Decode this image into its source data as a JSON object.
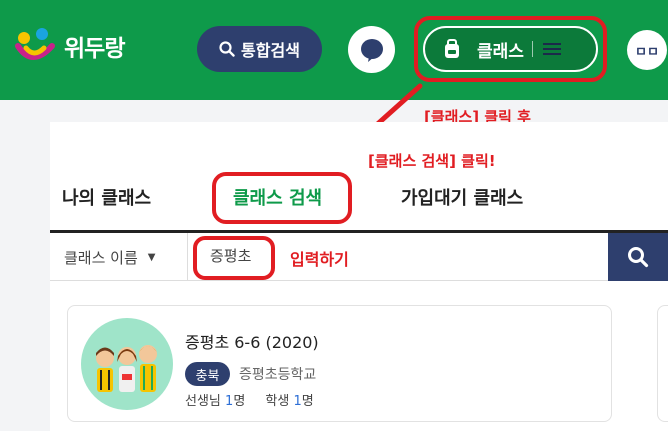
{
  "header": {
    "logo_text": "위두랑",
    "search_label": "통합검색",
    "class_label": "클래스",
    "avatar_label": "ㅁㅁ"
  },
  "annotations": {
    "after_click": "[클래스] 클릭 후",
    "click_search": "[클래스 검색] 클릭!",
    "type_input": "입력하기"
  },
  "tabs": [
    {
      "label": "나의 클래스",
      "active": false
    },
    {
      "label": "클래스 검색",
      "active": true
    },
    {
      "label": "가입대기 클래스",
      "active": false
    }
  ],
  "search": {
    "filter_label": "클래스 이름",
    "query": "증평초"
  },
  "results": [
    {
      "title": "증평초 6-6 (2020)",
      "region": "충북",
      "school": "증평초등학교",
      "teacher_label": "선생님",
      "teacher_count": "1",
      "student_label": "학생",
      "student_count": "1",
      "count_unit": "명"
    }
  ],
  "colors": {
    "header_green": "#0e9a4a",
    "navy": "#2e3f6e",
    "annotation_red": "#e11d22",
    "thumb_bg": "#9fe4c9"
  }
}
